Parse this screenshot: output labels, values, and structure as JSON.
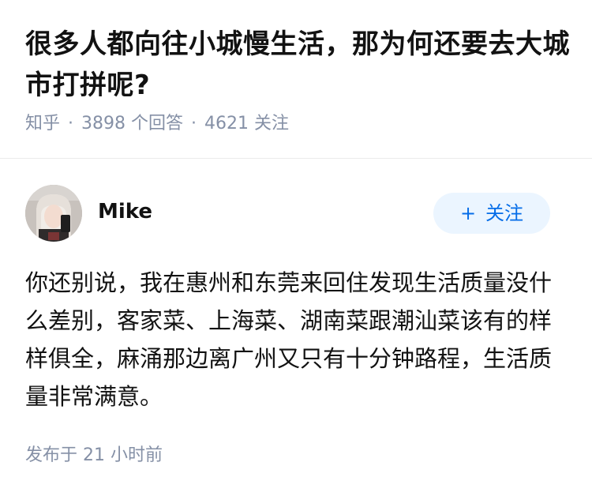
{
  "question": {
    "title": "很多人都向往小城慢生活，那为何还要去大城市打拼呢?",
    "site": "知乎",
    "separator": "·",
    "answer_count": "3898 个回答",
    "follower_count": "4621 关注"
  },
  "answer": {
    "author": {
      "name": "Mike",
      "avatar_icon": "user-avatar-photo"
    },
    "follow_button": {
      "plus": "+",
      "label": "关注"
    },
    "content": "你还别说，我在惠州和东莞来回住发现生活质量没什么差别，客家菜、上海菜、湖南菜跟潮汕菜该有的样样俱全，麻涌那边离广州又只有十分钟路程，生活质量非常满意。",
    "published": "发布于 21 小时前"
  },
  "colors": {
    "title": "#121212",
    "meta": "#8590a6",
    "accent": "#056de8",
    "button_bg": "#ebf5ff",
    "divider": "#ebebeb"
  }
}
